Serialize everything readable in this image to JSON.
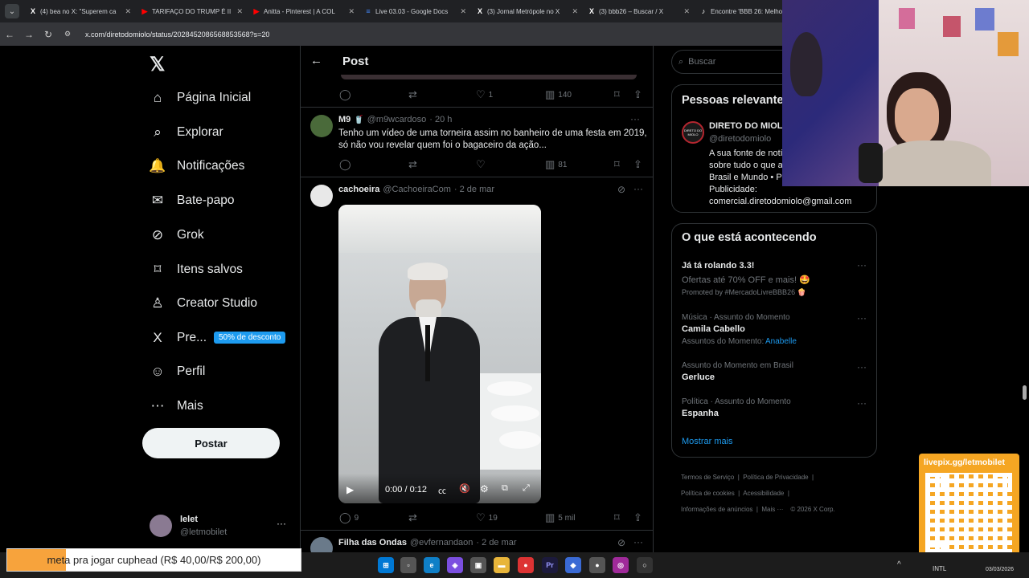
{
  "tabs": [
    {
      "icon": "X",
      "title": "(4) bea no X: \"Superem ca",
      "color": "#fff"
    },
    {
      "icon": "▶",
      "title": "TARIFAÇO DO TRUMP É II",
      "color": "#ff0000"
    },
    {
      "icon": "▶",
      "title": "Anitta - Pinterest | A COL",
      "color": "#ff0000"
    },
    {
      "icon": "≡",
      "title": "Live 03.03 - Google Docs",
      "color": "#4285f4"
    },
    {
      "icon": "X",
      "title": "(3) Jornal Metrópole no X",
      "color": "#fff"
    },
    {
      "icon": "X",
      "title": "(3) bbb26 – Buscar / X",
      "color": "#fff"
    },
    {
      "icon": "♪",
      "title": "Encontre 'BBB 26: Melhor",
      "color": "#fff"
    }
  ],
  "address": {
    "url": "x.com/diretodomiolo/status/2028452086568853568?s=20"
  },
  "nav": {
    "items": [
      {
        "label": "Página Inicial",
        "icon": "⌂",
        "name": "home-icon"
      },
      {
        "label": "Explorar",
        "icon": "⌕",
        "name": "search-icon"
      },
      {
        "label": "Notificações",
        "icon": "🔔",
        "name": "bell-icon",
        "badge": "6"
      },
      {
        "label": "Bate-papo",
        "icon": "✉",
        "name": "mail-icon"
      },
      {
        "label": "Grok",
        "icon": "⊘",
        "name": "grok-icon"
      },
      {
        "label": "Itens salvos",
        "icon": "⌑",
        "name": "bookmark-icon"
      },
      {
        "label": "Creator Studio",
        "icon": "♙",
        "name": "creator-icon"
      },
      {
        "label": "Pre...",
        "icon": "X",
        "name": "premium-icon"
      },
      {
        "label": "Perfil",
        "icon": "☺",
        "name": "profile-icon"
      },
      {
        "label": "Mais",
        "icon": "⋯",
        "name": "more-icon"
      }
    ],
    "promo": "50% de desconto",
    "post_button": "Postar",
    "account": {
      "name": "lelet",
      "handle": "@letmobilet"
    }
  },
  "header": {
    "title": "Post"
  },
  "top_actions": {
    "likes": "1",
    "views": "140"
  },
  "replies": [
    {
      "name": "M9",
      "handle": "@m9wcardoso",
      "time": "· 20 h",
      "text": "Tenho um vídeo de uma torneira assim no banheiro de uma festa em 2019, só não vou revelar quem foi o bagaceiro da ação...",
      "views": "81"
    },
    {
      "name": "cachoeira",
      "handle": "@CachoeiraCom",
      "time": "· 2 de mar",
      "video_time": "0:00 / 0:12",
      "replies": "9",
      "likes": "19",
      "views": "5 mil"
    },
    {
      "name": "Filha das Ondas",
      "handle": "@evfernandaon",
      "time": "· 2 de mar"
    }
  ],
  "right": {
    "search_placeholder": "Buscar",
    "relevant_title": "Pessoas relevantes",
    "relevant": {
      "name": "DIRETO DO MIOLO",
      "handle": "@diretodomiolo",
      "bio1": "A sua fonte de notícias",
      "bio2": "sobre tudo o que acontece",
      "bio3": "Brasil e Mundo • P",
      "bio4": "Publicidade:",
      "bio5": "comercial.diretodomiolo@gmail.com",
      "logo": "DIRETO DO MIOLO"
    },
    "trending_title": "O que está acontecendo",
    "trends": [
      {
        "meta": "",
        "name": "Já tá rolando 3.3!",
        "sub": "Ofertas até 70% OFF e mais! 🤩",
        "promo": "Promoted by #MercadoLivreBBB26 🍿"
      },
      {
        "meta": "Música · Assunto do Momento",
        "name": "Camila Cabello",
        "sub": "Assuntos do Momento:",
        "link": "Anabelle"
      },
      {
        "meta": "Assunto do Momento em Brasil",
        "name": "Gerluce"
      },
      {
        "meta": "Política · Assunto do Momento",
        "name": "Espanha"
      }
    ],
    "show_more": "Mostrar mais",
    "footer": [
      "Termos de Serviço",
      "Política de Privacidade",
      "Política de cookies",
      "Acessibilidade",
      "Informações de anúncios",
      "Mais ···",
      "© 2026 X Corp."
    ]
  },
  "overlay": {
    "goal": "meta pra jogar cuphead (R$ 40,00/R$ 200,00)",
    "livepix": "livepix.gg/letmobilet",
    "tray_text": "INTL",
    "date": "03/03/2026"
  }
}
